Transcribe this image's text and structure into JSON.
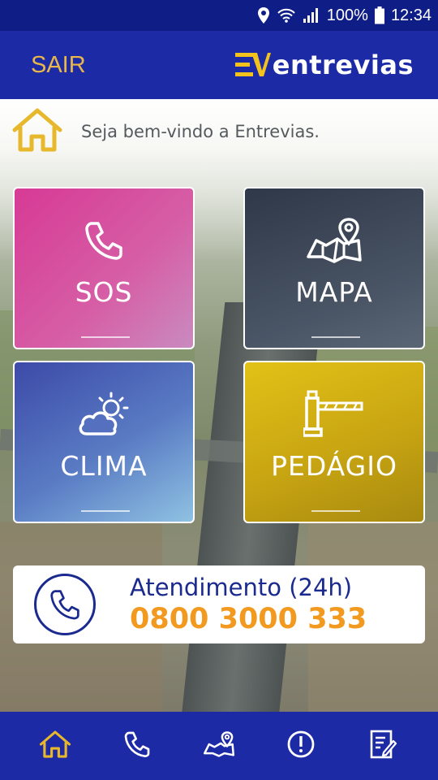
{
  "status_bar": {
    "battery": "100%",
    "time": "12:34",
    "icons": [
      "location-icon",
      "wifi-icon",
      "signal-icon",
      "battery-icon"
    ]
  },
  "app_bar": {
    "exit_label": "SAIR",
    "logo_text": "entrevias"
  },
  "welcome": {
    "icon": "home-icon",
    "text": "Seja bem-vindo a Entrevias."
  },
  "tiles": [
    {
      "label": "SOS",
      "icon": "phone-icon",
      "color": "#d73a95"
    },
    {
      "label": "MAPA",
      "icon": "map-pin-icon",
      "color": "#3a4455"
    },
    {
      "label": "CLIMA",
      "icon": "weather-icon",
      "color": "#4a6cc0"
    },
    {
      "label": "PEDÁGIO",
      "icon": "toll-barrier-icon",
      "color": "#d4b314"
    }
  ],
  "support": {
    "title": "Atendimento (24h)",
    "number": "0800 3000 333"
  },
  "bottom_nav": [
    {
      "name": "home",
      "icon": "home-icon",
      "active": true
    },
    {
      "name": "call",
      "icon": "phone-icon",
      "active": false
    },
    {
      "name": "map",
      "icon": "map-icon",
      "active": false
    },
    {
      "name": "alerts",
      "icon": "alert-icon",
      "active": false
    },
    {
      "name": "documents",
      "icon": "document-icon",
      "active": false
    }
  ],
  "colors": {
    "brand_blue": "#1d2aa6",
    "accent_yellow": "#e9b64a",
    "number_orange": "#f29a1f"
  }
}
